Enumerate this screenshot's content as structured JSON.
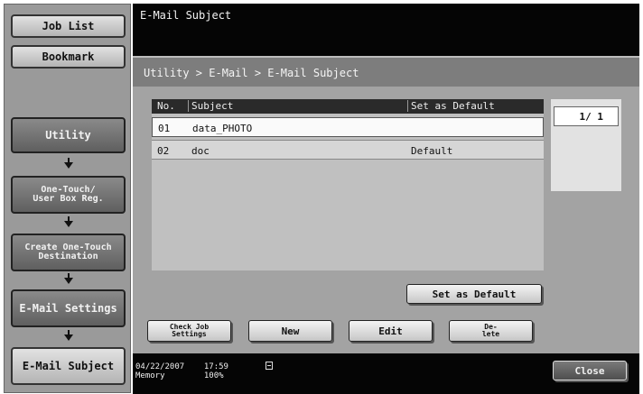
{
  "sidebar": {
    "job_list": "Job List",
    "bookmark": "Bookmark",
    "utility": "Utility",
    "one_touch": [
      "One-Touch/",
      "User Box Reg."
    ],
    "create_dest": [
      "Create One-Touch",
      "Destination"
    ],
    "email_settings": "E-Mail Settings",
    "email_subject": "E-Mail Subject"
  },
  "header": {
    "title": "E-Mail Subject"
  },
  "breadcrumb": "Utility > E-Mail > E-Mail Subject",
  "table": {
    "columns": [
      "No.",
      "Subject",
      "Set as Default"
    ],
    "rows": [
      {
        "no": "01",
        "subject": "data_PHOTO",
        "default": ""
      },
      {
        "no": "02",
        "subject": "doc",
        "default": "Default"
      }
    ]
  },
  "pager": {
    "text": "1/ 1"
  },
  "buttons": {
    "set_default": "Set as Default",
    "check_job": [
      "Check Job",
      "Settings"
    ],
    "new": "New",
    "edit": "Edit",
    "delete": [
      "De-",
      "lete"
    ],
    "close": "Close"
  },
  "status": {
    "date": "04/22/2007",
    "time": "17:59",
    "memory_label": "Memory",
    "memory_value": "100%"
  },
  "colors": {
    "header_bg": "#050505",
    "panel_bg": "#a3a3a3",
    "sidebar_bg": "#9a9a9a"
  }
}
